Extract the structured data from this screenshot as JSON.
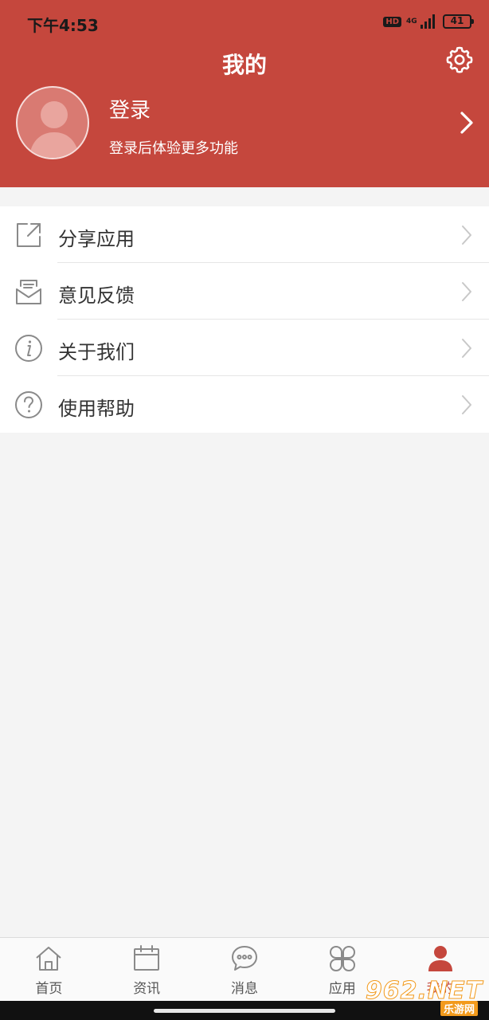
{
  "status_bar": {
    "time": "下午4:53",
    "hd_label": "HD",
    "network": "4G",
    "battery": "41"
  },
  "header": {
    "title": "我的",
    "settings_icon": "gear-icon"
  },
  "profile": {
    "login_label": "登录",
    "login_hint": "登录后体验更多功能",
    "avatar_icon": "user-silhouette-icon"
  },
  "menu": {
    "items": [
      {
        "label": "分享应用",
        "icon": "share-icon"
      },
      {
        "label": "意见反馈",
        "icon": "mail-feedback-icon"
      },
      {
        "label": "关于我们",
        "icon": "info-icon"
      },
      {
        "label": "使用帮助",
        "icon": "help-icon"
      }
    ]
  },
  "tabbar": {
    "tabs": [
      {
        "label": "首页",
        "icon": "home-icon",
        "active": false
      },
      {
        "label": "资讯",
        "icon": "calendar-icon",
        "active": false
      },
      {
        "label": "消息",
        "icon": "chat-bubble-icon",
        "active": false
      },
      {
        "label": "应用",
        "icon": "apps-grid-icon",
        "active": false
      },
      {
        "label": "我的",
        "icon": "person-icon",
        "active": true
      }
    ]
  },
  "watermark": {
    "main": "962.NET",
    "sub": "乐游网"
  },
  "colors": {
    "accent": "#c5473d",
    "background": "#f4f4f4",
    "watermark": "#f29a1c"
  }
}
